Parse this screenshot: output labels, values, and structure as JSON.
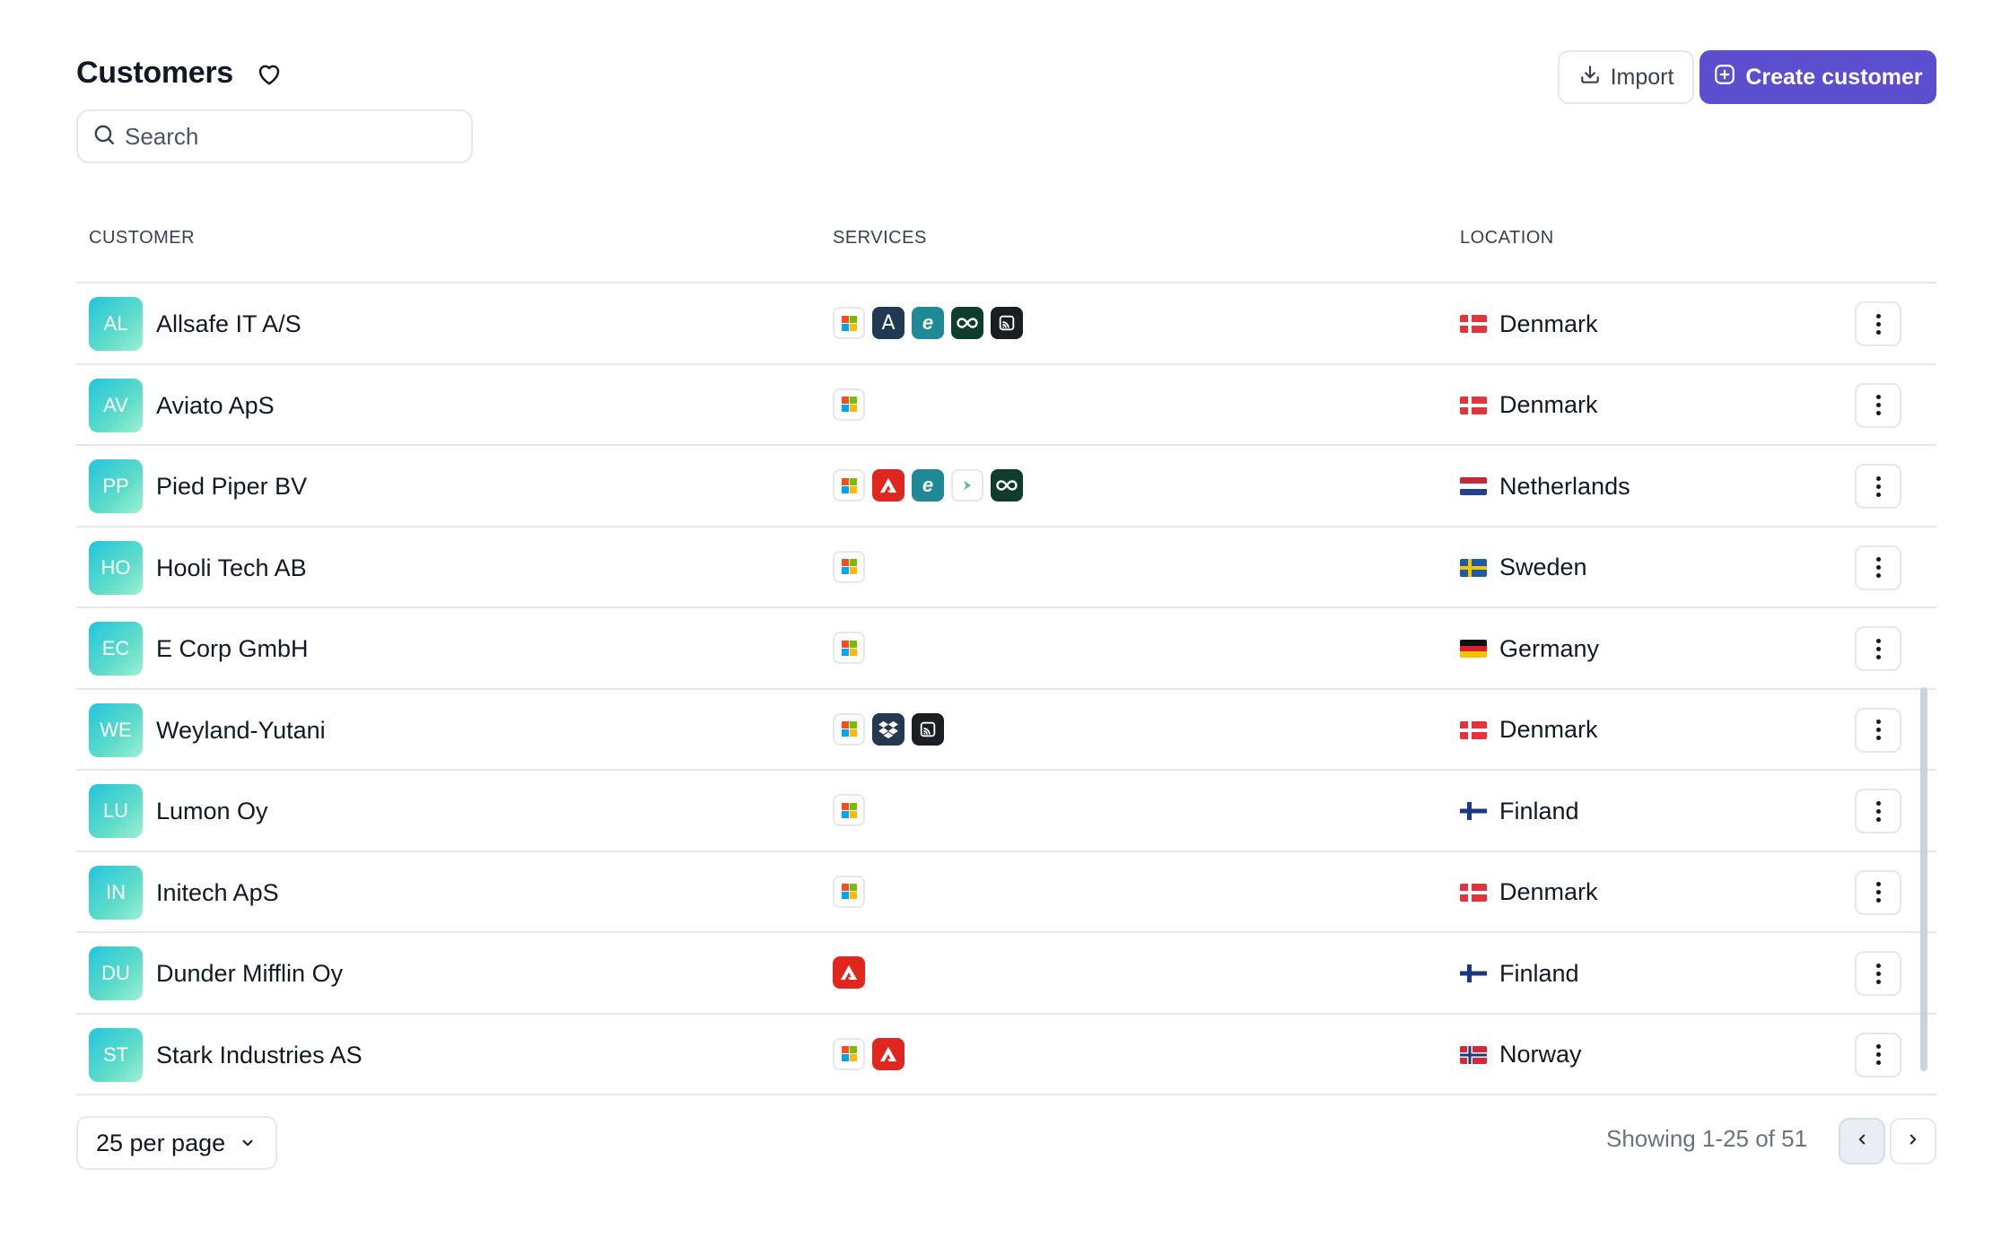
{
  "header": {
    "title": "Customers",
    "favorite_icon": "heart-icon",
    "import_label": "Import",
    "create_label": "Create customer",
    "accent_color": "#5b4fcf"
  },
  "search": {
    "placeholder": "Search",
    "value": ""
  },
  "table": {
    "columns": {
      "customer": "CUSTOMER",
      "services": "SERVICES",
      "location": "LOCATION"
    },
    "rows": [
      {
        "initials": "AL",
        "name": "Allsafe IT A/S",
        "services": [
          "microsoft",
          "a-dark",
          "e-teal",
          "loop",
          "cast"
        ],
        "flag": "dk",
        "location": "Denmark"
      },
      {
        "initials": "AV",
        "name": "Aviato ApS",
        "services": [
          "microsoft"
        ],
        "flag": "dk",
        "location": "Denmark"
      },
      {
        "initials": "PP",
        "name": "Pied Piper BV",
        "services": [
          "microsoft",
          "adobe",
          "e-teal",
          "leaf",
          "loop"
        ],
        "flag": "nl",
        "location": "Netherlands"
      },
      {
        "initials": "HO",
        "name": "Hooli Tech AB",
        "services": [
          "microsoft"
        ],
        "flag": "se",
        "location": "Sweden"
      },
      {
        "initials": "EC",
        "name": "E Corp GmbH",
        "services": [
          "microsoft"
        ],
        "flag": "de",
        "location": "Germany"
      },
      {
        "initials": "WE",
        "name": "Weyland-Yutani",
        "services": [
          "microsoft",
          "dropbox",
          "cast"
        ],
        "flag": "dk",
        "location": "Denmark"
      },
      {
        "initials": "LU",
        "name": "Lumon Oy",
        "services": [
          "microsoft"
        ],
        "flag": "fi",
        "location": "Finland"
      },
      {
        "initials": "IN",
        "name": "Initech ApS",
        "services": [
          "microsoft"
        ],
        "flag": "dk",
        "location": "Denmark"
      },
      {
        "initials": "DU",
        "name": "Dunder Mifflin Oy",
        "services": [
          "adobe"
        ],
        "flag": "fi",
        "location": "Finland"
      },
      {
        "initials": "ST",
        "name": "Stark Industries AS",
        "services": [
          "microsoft",
          "adobe"
        ],
        "flag": "no",
        "location": "Norway"
      }
    ]
  },
  "footer": {
    "per_page": "25 per page",
    "showing": "Showing 1-25 of 51"
  }
}
